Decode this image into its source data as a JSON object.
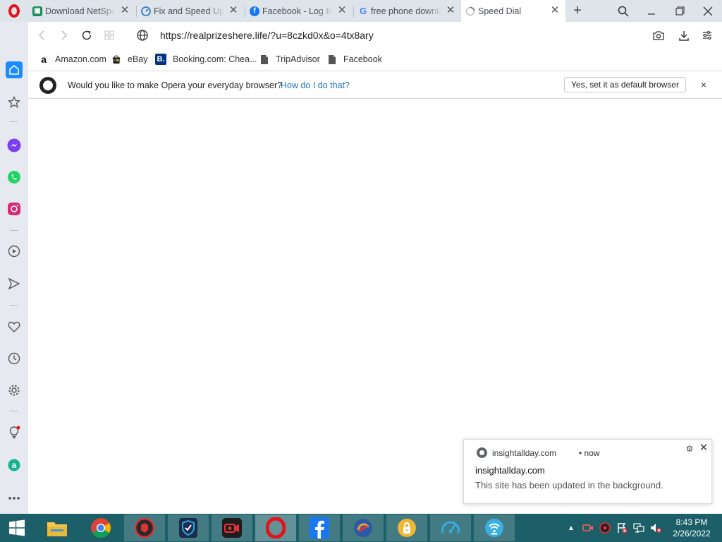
{
  "browser": {
    "tabs": [
      {
        "label": "Download NetSpot",
        "icon": "netspot-favicon",
        "color": "#1e8c5a"
      },
      {
        "label": "Fix and Speed Up",
        "icon": "speedometer-favicon",
        "color": "#1b6fd1"
      },
      {
        "label": "Facebook - Log In",
        "icon": "facebook-favicon",
        "color": "#1877f2"
      },
      {
        "label": "free phone downloads",
        "icon": "google-favicon",
        "color": "#4285f4"
      },
      {
        "label": "Speed Dial",
        "icon": "loading-spinner-icon",
        "active": true
      }
    ],
    "new_tab_label": "+",
    "url": "https://realprizeshere.life/?u=8czkd0x&o=4tx8ary",
    "bookmarks": [
      {
        "label": "Amazon.com",
        "icon": "amazon-icon"
      },
      {
        "label": "eBay",
        "icon": "ebay-icon"
      },
      {
        "label": "Booking.com: Chea...",
        "icon": "booking-icon"
      },
      {
        "label": "TripAdvisor",
        "icon": "page-icon"
      },
      {
        "label": "Facebook",
        "icon": "page-icon"
      }
    ]
  },
  "infobar": {
    "message": "Would you like to make Opera your everyday browser?",
    "link": "How do I do that?",
    "button": "Yes, set it as default browser",
    "close": "×"
  },
  "sidebar": {
    "items": [
      "home-icon",
      "star-icon",
      "messenger-icon",
      "whatsapp-icon",
      "instagram-icon",
      "player-icon",
      "send-icon",
      "heart-icon",
      "history-icon",
      "settings-icon",
      "lightbulb-icon",
      "aria-icon",
      "more-icon"
    ]
  },
  "notification": {
    "origin": "insightallday.com",
    "time": "• now",
    "title": "insightallday.com",
    "body": "This site has been updated in the background."
  },
  "taskbar": {
    "apps": [
      "file-explorer-icon",
      "chrome-icon",
      "security-app-icon",
      "vpn-shield-icon",
      "screen-recorder-icon",
      "opera-icon",
      "facebook-icon",
      "cleaner-icon",
      "password-icon",
      "speed-test-icon",
      "wifi-app-icon"
    ],
    "clock_time": "8:43 PM",
    "clock_date": "2/26/2022"
  },
  "colors": {
    "accent": "#e3131b",
    "sidebar_active": "#1a8cff",
    "taskbar": "#1c5f68"
  }
}
